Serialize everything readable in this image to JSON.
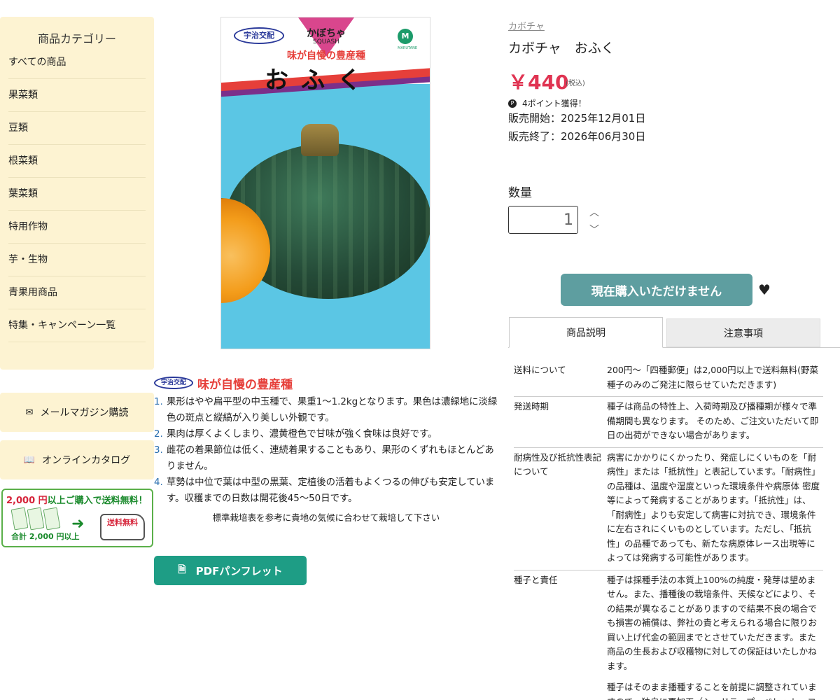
{
  "sidebar": {
    "title": "商品カテゴリー",
    "items": [
      "すべての商品",
      "果菜類",
      "豆類",
      "根菜類",
      "葉菜類",
      "特用作物",
      "芋・生物",
      "青果用商品",
      "特集・キャンペーン一覧"
    ],
    "mail_label": "メールマガジン購読",
    "catalog_label": "オンラインカタログ",
    "banner": {
      "amount": "2,000 円",
      "text": "以上ご購入で送料無料！",
      "total": "合計 2,000 円以上",
      "free": "送料無料"
    }
  },
  "package": {
    "brand": "宇治交配",
    "kind": "かぼちゃ",
    "kind_en": "SQUASH",
    "maker": "MARUTANE",
    "subtitle": "味が自慢の豊産種",
    "name": "おふく"
  },
  "description": {
    "badge": "宇治交配",
    "title": "味が自慢の豊産種",
    "points": [
      {
        "num": "1.",
        "text": "果形はやや扁平型の中玉種で、果重1〜1.2kgとなります。果色は濃緑地に淡緑色の斑点と縦縞が入り美しい外観です。"
      },
      {
        "num": "2.",
        "text": "果肉は厚くよくしまり、濃黄橙色で甘味が強く食味は良好です。"
      },
      {
        "num": "3.",
        "text": "雌花の着果節位は低く、連続着果することもあり、果形のくずれもほとんどありません。"
      },
      {
        "num": "4.",
        "text": "草勢は中位で葉は中型の黒葉、定植後の活着もよくつるの伸びも安定しています。収穫までの日数は開花後45〜50日です。"
      }
    ],
    "note": "標準栽培表を参考に貴地の気候に合わせて栽培して下さい",
    "pdf_label": "PDFパンフレット"
  },
  "product": {
    "breadcrumb": "カボチャ",
    "name": "カボチャ　おふく",
    "price": "￥440",
    "tax": "(税込)",
    "points": "4ポイント獲得！",
    "sale_start": "販売開始：2025年12月01日",
    "sale_end": "販売終了：2026年06月30日",
    "qty_label": "数量",
    "qty_value": "1",
    "buy_label": "現在購入いただけません"
  },
  "tabs": {
    "desc": "商品説明",
    "note": "注意事項"
  },
  "info": [
    {
      "key": "送料について",
      "val": "200円〜「四種郵便」は2,000円以上で送料無料(野菜種子のみのご発注に限らせていただきます)"
    },
    {
      "key": "発送時期",
      "val": "種子は商品の特性上、入荷時期及び播種期が様々で準備期間も異なります。 そのため、ご注文いただいて即日の出荷ができない場合があります。"
    },
    {
      "key": "耐病性及び抵抗性表記について",
      "val": "病害にかかりにくかったり、発症しにくいものを「耐病性」または「抵抗性」と表記しています。「耐病性」の品種は、温度や湿度といった環境条件や病原体 密度等によって発病することがあります。「抵抗性」は、「耐病性」よりも安定して病害に対抗でき、環境条件に左右されにくいものとしています。ただし、「抵抗性」の品種であっても、新たな病原体レース出現等によっては発病する可能性があります。"
    },
    {
      "key": "種子と責任",
      "val": "種子は採種手法の本質上100%の純度・発芽は望めません。また、播種後の栽培条件、天候などにより、その結果が異なることがありますので結果不良の場合でも損害の補償は、弊社の責と考えられる場合に限りお買い上げ代金の範囲までとさせていただきます。また商品の生長および収穫物に対しての保証はいたしかねます。"
    }
  ],
  "info_extra": "種子はそのまま播種することを前提に調整されていますので、独自に再加工（シードテープ・ペレット・コ"
}
